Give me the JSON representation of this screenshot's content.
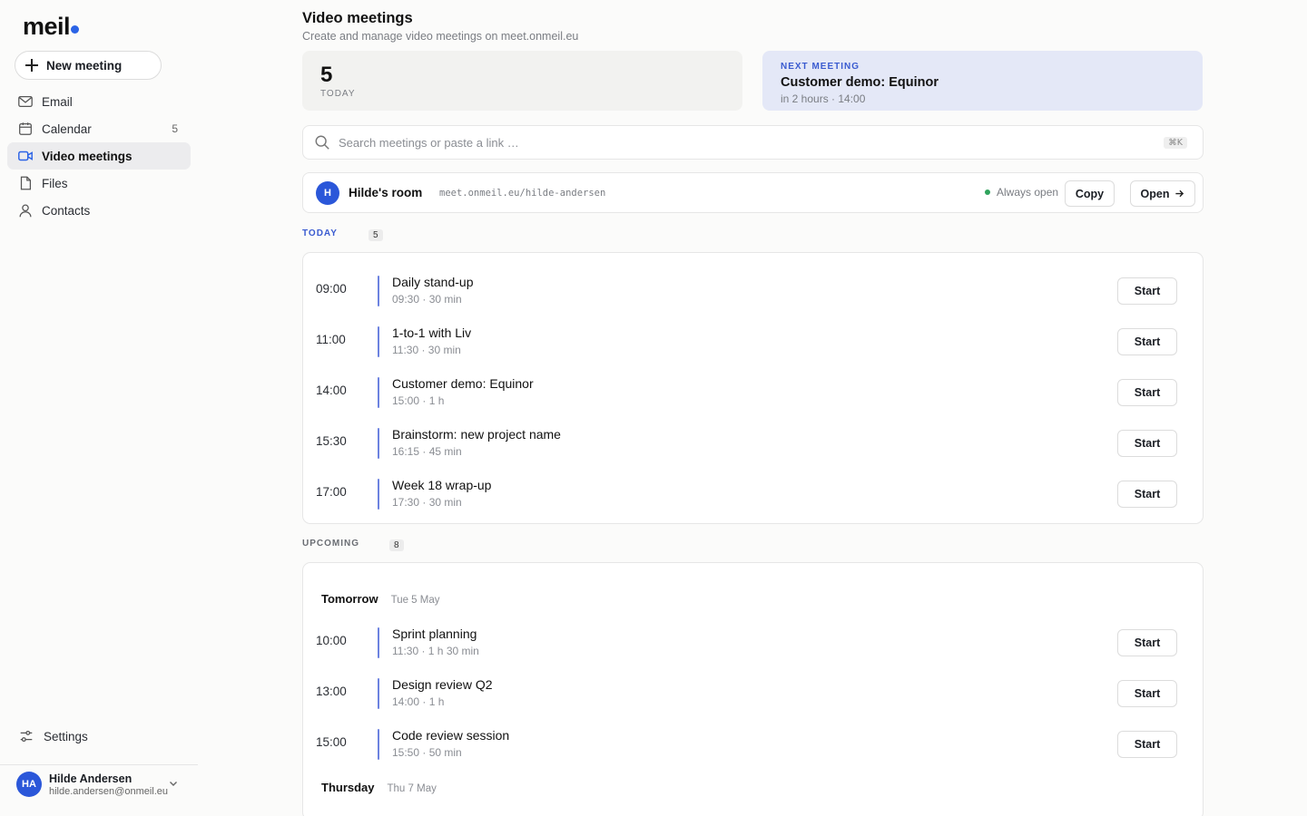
{
  "app": {
    "logo": "meil"
  },
  "sidebar": {
    "new_meeting_label": "New meeting",
    "items": [
      {
        "label": "Email",
        "icon": "mail-icon"
      },
      {
        "label": "Calendar",
        "icon": "calendar-icon",
        "count": "5"
      },
      {
        "label": "Video meetings",
        "icon": "video-icon",
        "active": true
      },
      {
        "label": "Files",
        "icon": "file-icon"
      },
      {
        "label": "Contacts",
        "icon": "user-icon"
      }
    ],
    "settings_label": "Settings",
    "user": {
      "initials": "HA",
      "name": "Hilde Andersen",
      "email": "hilde.andersen@onmeil.eu"
    }
  },
  "header": {
    "title": "Video meetings",
    "subtitle": "Create and manage video meetings on meet.onmeil.eu"
  },
  "stats": {
    "count": "5",
    "label": "TODAY"
  },
  "next_meeting": {
    "label": "NEXT MEETING",
    "title": "Customer demo: Equinor",
    "sub": "in 2 hours · 14:00"
  },
  "search": {
    "placeholder": "Search meetings or paste a link …",
    "shortcut": "⌘K"
  },
  "room": {
    "initial": "H",
    "name": "Hilde's room",
    "link": "meet.onmeil.eu/hilde-andersen",
    "status": "Always open",
    "copy_label": "Copy",
    "open_label": "Open"
  },
  "colors": {
    "accent": "#2b57d9",
    "bar": "#6c82e0",
    "status_green": "#2fa35c",
    "next_bg": "#e4e8f7"
  },
  "today": {
    "label": "TODAY",
    "count": "5",
    "meetings": [
      {
        "time": "09:00",
        "title": "Daily stand-up",
        "sub": "09:30 · 30 min",
        "action": "Start"
      },
      {
        "time": "11:00",
        "title": "1-to-1 with Liv",
        "sub": "11:30 · 30 min",
        "action": "Start"
      },
      {
        "time": "14:00",
        "title": "Customer demo: Equinor",
        "sub": "15:00 · 1 h",
        "action": "Start"
      },
      {
        "time": "15:30",
        "title": "Brainstorm: new project name",
        "sub": "16:15 · 45 min",
        "action": "Start"
      },
      {
        "time": "17:00",
        "title": "Week 18 wrap-up",
        "sub": "17:30 · 30 min",
        "action": "Start"
      }
    ]
  },
  "upcoming": {
    "label": "UPCOMING",
    "count": "8",
    "days": [
      {
        "name": "Tomorrow",
        "date": "Tue 5 May"
      },
      {
        "name": "Thursday",
        "date": "Thu 7 May"
      }
    ],
    "meetings": [
      {
        "time": "10:00",
        "title": "Sprint planning",
        "sub": "11:30 · 1 h 30 min",
        "action": "Start"
      },
      {
        "time": "13:00",
        "title": "Design review Q2",
        "sub": "14:00 · 1 h",
        "action": "Start"
      },
      {
        "time": "15:00",
        "title": "Code review session",
        "sub": "15:50 · 50 min",
        "action": "Start"
      }
    ]
  }
}
